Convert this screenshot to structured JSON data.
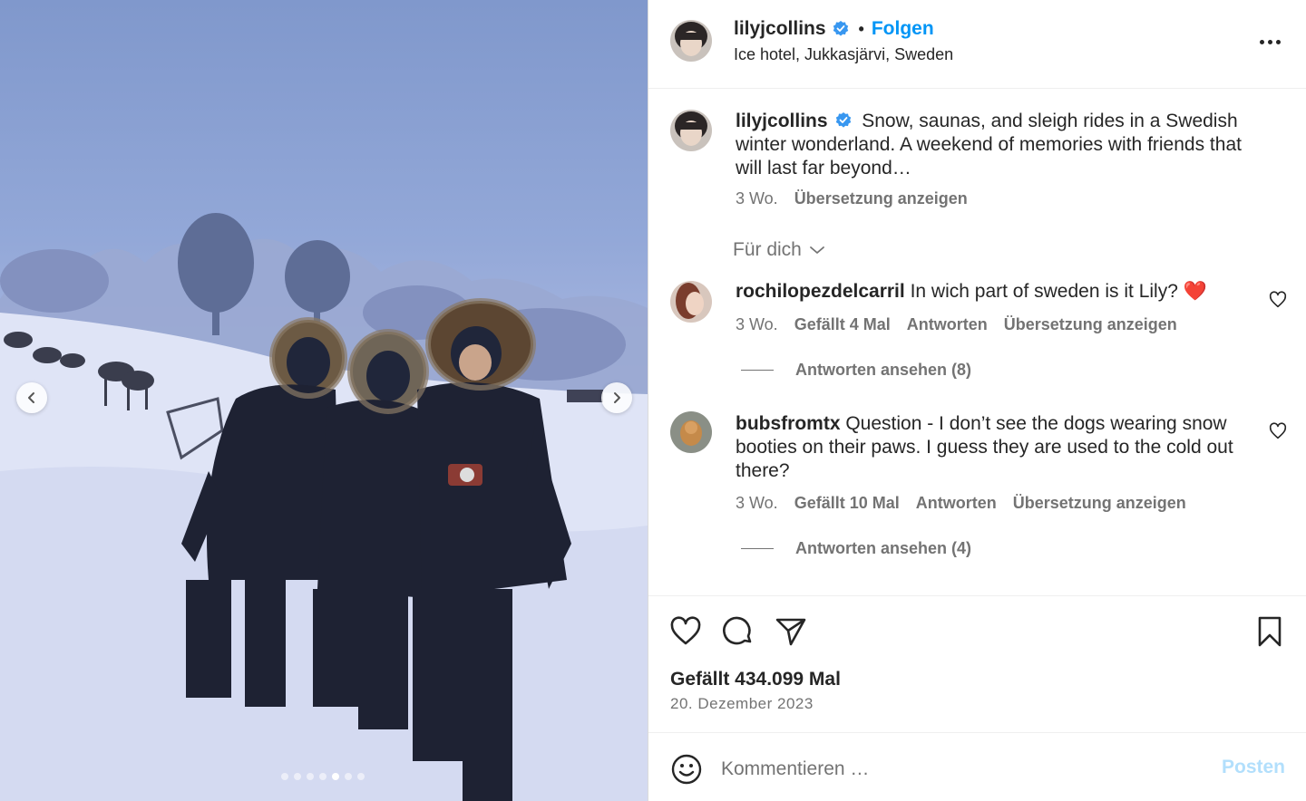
{
  "header": {
    "username": "lilyjcollins",
    "separator": "•",
    "follow_label": "Folgen",
    "location": "Ice hotel, Jukkasjärvi, Sweden"
  },
  "caption": {
    "username": "lilyjcollins",
    "text": "Snow, saunas, and sleigh rides in a Swedish winter wonderland. A weekend of memories with friends that will last far beyond…",
    "time": "3 Wo.",
    "translate_label": "Übersetzung anzeigen"
  },
  "filter_label": "Für dich",
  "comments": [
    {
      "username": "rochilopezdelcarril",
      "text": "In wich part of sweden is it Lily?",
      "emoji": "❤️",
      "time": "3 Wo.",
      "likes_label": "Gefällt 4 Mal",
      "reply_label": "Antworten",
      "translate_label": "Übersetzung anzeigen",
      "view_replies_label": "Antworten ansehen (8)"
    },
    {
      "username": "bubsfromtx",
      "text": "Question - I don’t see the dogs wearing snow booties on their paws. I guess they are used to the cold out there?",
      "time": "3 Wo.",
      "likes_label": "Gefällt 10 Mal",
      "reply_label": "Antworten",
      "translate_label": "Übersetzung anzeigen",
      "view_replies_label": "Antworten ansehen (4)"
    }
  ],
  "stats": {
    "likes_label": "Gefällt 434.099 Mal",
    "date": "20. Dezember 2023"
  },
  "comment_box": {
    "placeholder": "Kommentieren …",
    "post_label": "Posten"
  },
  "carousel": {
    "slide_count": 7,
    "active_index": 4
  },
  "icons": {
    "verified": "verified-badge-icon",
    "more": "more-options-icon",
    "like": "heart-icon",
    "comment": "comment-bubble-icon",
    "share": "paper-plane-icon",
    "save": "bookmark-icon",
    "emoji": "smiley-icon",
    "chevron": "chevron-down-icon"
  },
  "colors": {
    "accent": "#0095f6",
    "verified": "#3897f0",
    "muted": "#737373",
    "post_disabled": "#b2dffc"
  }
}
